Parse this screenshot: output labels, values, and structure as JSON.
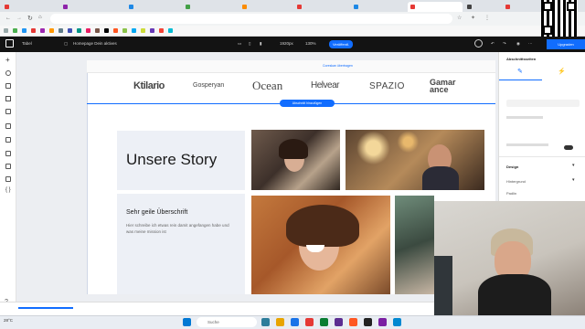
{
  "browser": {
    "tabs": [
      {
        "label": "",
        "color": "#e53935"
      },
      {
        "label": "",
        "color": "#8e24aa"
      },
      {
        "label": "",
        "color": "#1e88e5"
      },
      {
        "label": "",
        "color": "#43a047"
      },
      {
        "label": "",
        "color": "#fb8c00"
      },
      {
        "label": "",
        "color": "#e53935"
      },
      {
        "label": "",
        "color": "#1e88e5"
      },
      {
        "label": "",
        "color": "#e53935"
      },
      {
        "label": "",
        "color": "#424242"
      },
      {
        "label": "",
        "color": "#e53935"
      }
    ],
    "url": ""
  },
  "editor": {
    "site_menu": "Tabel",
    "page_selector": "Homepage Dein aktives",
    "zoom_device": "1920px",
    "zoom_level": "130%",
    "publish_label": "Veröffentl.",
    "upgrade_label": "Upgraden"
  },
  "canvas": {
    "header_link": "Coreskan übertragen",
    "logos": [
      "Ktilario",
      "Gosperyan",
      "Ocean",
      "Helvear",
      "SPAZIO",
      "Gamar ance"
    ],
    "section_button": "Abschnitt hinzufügen",
    "story_title": "Unsere Story",
    "sub_title": "Sehr geile Überschrift",
    "sub_body": "Hier schreibe ich etwas rein damit angefangen habe und was meine mission ist"
  },
  "right_panel": {
    "title": "Abschnittsseiten",
    "design_label": "Design",
    "background_label": "Hintergrund",
    "padding_label": "Padlin"
  },
  "taskbar": {
    "search_placeholder": "Suche",
    "temperature": "28°C"
  },
  "colors": {
    "accent": "#116dff",
    "toolbar": "#131313"
  }
}
